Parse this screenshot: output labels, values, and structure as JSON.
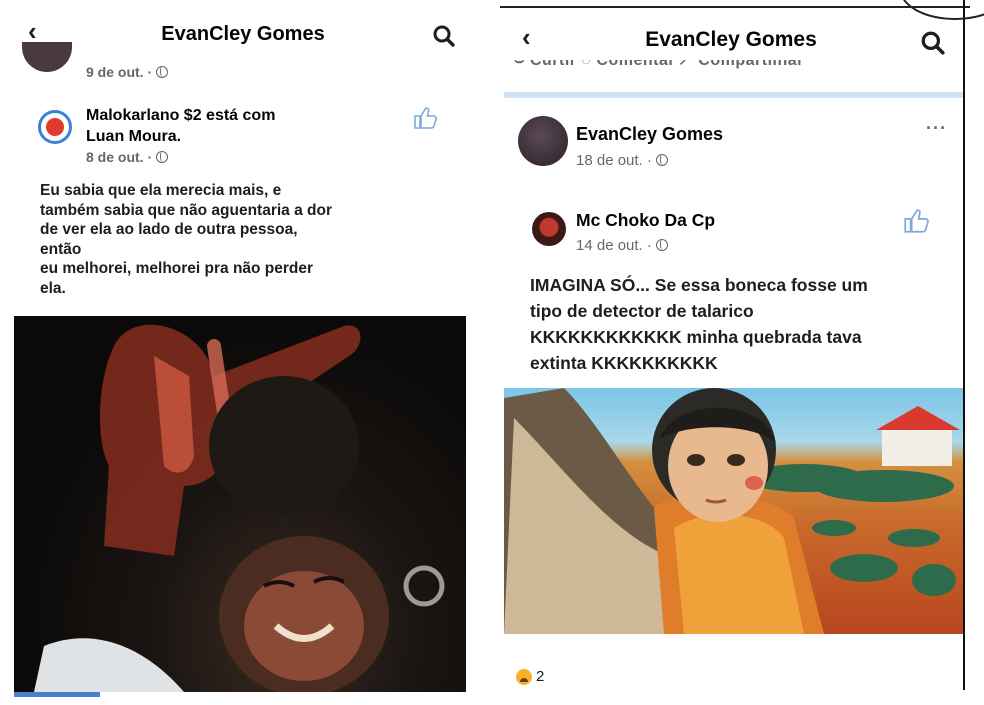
{
  "left": {
    "header": {
      "title": "EvanCley Gomes"
    },
    "previous_post": {
      "date": "9 de out. ·"
    },
    "post": {
      "author_line1": "Malokarlano $2 está com",
      "author_line2": "Luan Moura.",
      "date": "8 de out. ·",
      "text_lines": [
        "Eu sabia que ela merecia mais, e",
        "também sabia que não aguentaria a dor",
        "de ver ela ao lado de outra pessoa,",
        "então",
        "eu melhorei, melhorei pra não perder",
        "ela."
      ]
    }
  },
  "right": {
    "header": {
      "title": "EvanCley Gomes"
    },
    "action_bar_partial": "⌣ Curtir   ◌ Comentar   ↗ Compartilhar",
    "sharer": {
      "name": "EvanCley Gomes",
      "date": "18 de out. ·",
      "more": "···"
    },
    "original": {
      "name": "Mc Choko Da Cp",
      "date": "14 de out. ·",
      "text_lines": [
        "IMAGINA SÓ... Se essa boneca fosse um",
        "tipo de detector de talarico",
        "KKKKKKKKKKKK minha quebrada tava",
        "extinta KKKKKKKKKK"
      ]
    },
    "reactions": {
      "count": "2"
    }
  },
  "colors": {
    "accent_blue": "#1877f2",
    "meta_gray": "#65676b",
    "divider_blue": "#cfe3f5"
  }
}
